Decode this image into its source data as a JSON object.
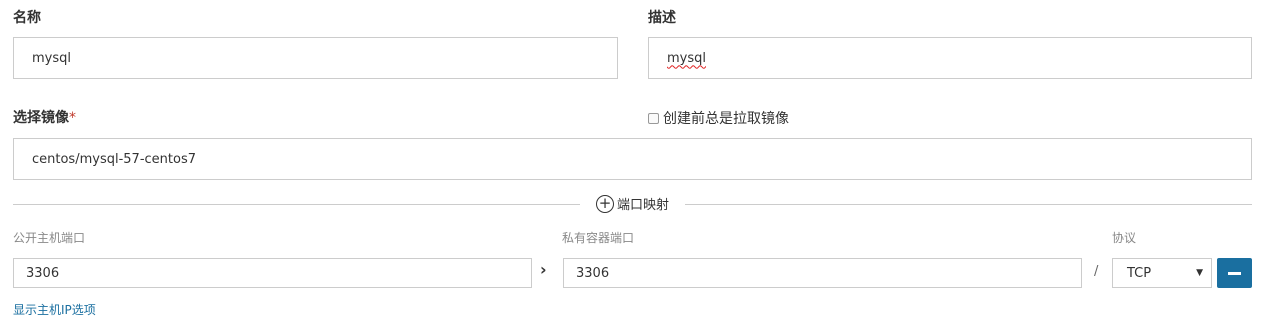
{
  "form": {
    "name": {
      "label": "名称",
      "value": "mysql"
    },
    "description": {
      "label": "描述",
      "value": "mysql"
    },
    "image": {
      "label": "选择镜像",
      "required_mark": "*",
      "value": "centos/mysql-57-centos7"
    },
    "always_pull": {
      "label": "创建前总是拉取镜像",
      "checked": false
    }
  },
  "port_mapping": {
    "add_label": "端口映射",
    "add_icon": "plus-circle-icon",
    "columns": {
      "public_port": "公开主机端口",
      "private_port": "私有容器端口",
      "protocol": "协议"
    },
    "row": {
      "public_port": "3306",
      "arrow": "›",
      "private_port": "3306",
      "slash": "/",
      "protocol": "TCP"
    },
    "show_host_ip_link": "显示主机IP选项"
  },
  "colors": {
    "accent": "#1a6fa0",
    "border": "#cccccc"
  }
}
